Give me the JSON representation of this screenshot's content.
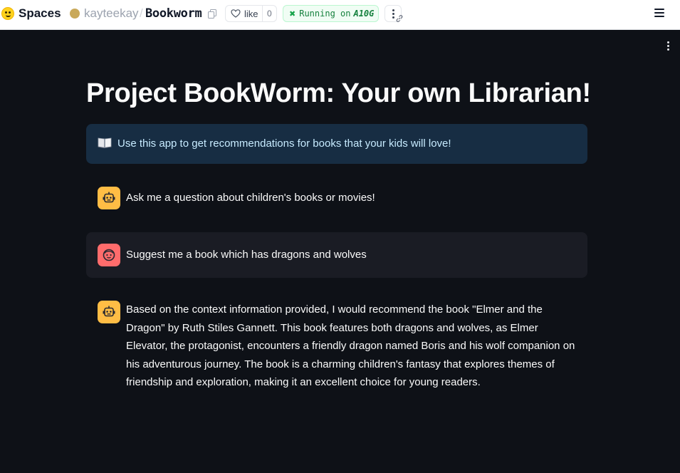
{
  "topbar": {
    "spaces_label": "Spaces",
    "owner": "kayteekay",
    "separator": "/",
    "repo": "Bookworm",
    "like_label": "like",
    "like_count": "0",
    "status_running": "Running on",
    "status_hardware": "A10G"
  },
  "app": {
    "title": "Project BookWorm: Your own Librarian!",
    "info_text": "Use this app to get recommendations for books that your kids will love!"
  },
  "chat": {
    "messages": [
      {
        "role": "assistant",
        "avatar_icon": "robot-icon",
        "text": "Ask me a question about children's books or movies!"
      },
      {
        "role": "user",
        "avatar_icon": "face-icon",
        "text": "Suggest me a book which has dragons and wolves"
      },
      {
        "role": "assistant",
        "avatar_icon": "robot-icon",
        "text": "Based on the context information provided, I would recommend the book \"Elmer and the Dragon\" by Ruth Stiles Gannett. This book features both dragons and wolves, as Elmer Elevator, the protagonist, encounters a friendly dragon named Boris and his wolf companion on his adventurous journey. The book is a charming children's fantasy that explores themes of friendship and exploration, making it an excellent choice for young readers."
      }
    ]
  },
  "colors": {
    "app_background": "#0e1117",
    "info_background": "#172d43",
    "info_text": "#c7ebff",
    "bot_avatar": "#ffbd45",
    "user_avatar": "#ff6c6c",
    "user_message_background": "#1a1c24",
    "running_badge": "#f0fdf4"
  }
}
